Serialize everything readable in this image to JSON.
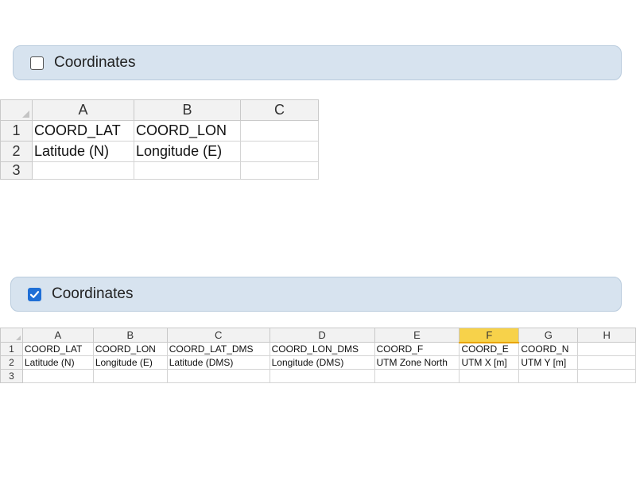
{
  "panel_top": {
    "label": "Coordinates",
    "checked": false
  },
  "sheet_top": {
    "columns": [
      "A",
      "B",
      "C"
    ],
    "rows": [
      {
        "num": "1",
        "cells": [
          "COORD_LAT",
          "COORD_LON",
          ""
        ]
      },
      {
        "num": "2",
        "cells": [
          "Latitude (N)",
          "Longitude (E)",
          ""
        ]
      },
      {
        "num": "3",
        "cells": [
          "",
          "",
          ""
        ]
      }
    ]
  },
  "panel_bottom": {
    "label": "Coordinates",
    "checked": true
  },
  "sheet_bottom": {
    "columns": [
      "A",
      "B",
      "C",
      "D",
      "E",
      "F",
      "G",
      "H"
    ],
    "selected_column": "F",
    "rows": [
      {
        "num": "1",
        "cells": [
          "COORD_LAT",
          "COORD_LON",
          "COORD_LAT_DMS",
          "COORD_LON_DMS",
          "COORD_F",
          "COORD_E",
          "COORD_N",
          ""
        ]
      },
      {
        "num": "2",
        "cells": [
          "Latitude (N)",
          "Longitude (E)",
          "Latitude (DMS)",
          "Longitude (DMS)",
          "UTM Zone North",
          "UTM X [m]",
          "UTM Y [m]",
          ""
        ]
      },
      {
        "num": "3",
        "cells": [
          "",
          "",
          "",
          "",
          "",
          "",
          "",
          ""
        ]
      }
    ]
  },
  "colors": {
    "panel_bg": "#d7e3ef",
    "checkbox_checked": "#1f6fd6",
    "selected_header": "#f7d24a"
  }
}
